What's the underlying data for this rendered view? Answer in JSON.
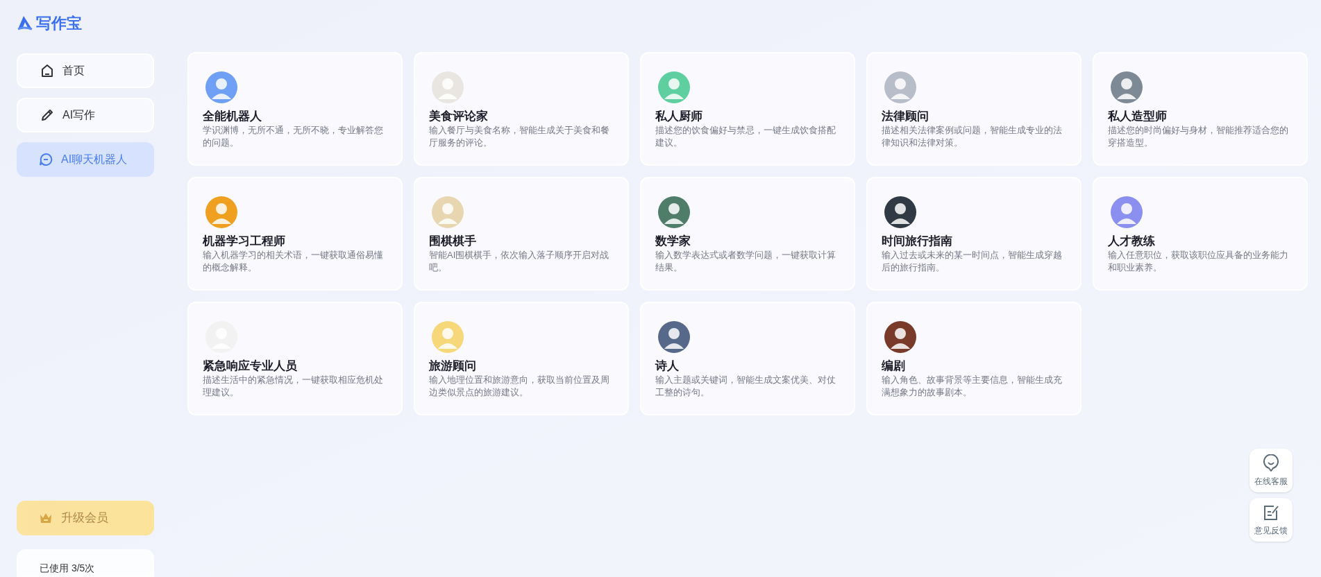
{
  "logo": {
    "text": "写作宝"
  },
  "sidebar": {
    "items": [
      {
        "label": "首页",
        "selected": false
      },
      {
        "label": "AI写作",
        "selected": false
      },
      {
        "label": "AI聊天机器人",
        "selected": true
      }
    ],
    "upgrade_button": "升级会员",
    "usage": "已使用 3/5次"
  },
  "cards": [
    {
      "title": "全能机器人",
      "description": "学识渊博，无所不通，无所不晓，专业解答您的问题。"
    },
    {
      "title": "美食评论家",
      "description": "输入餐厅与美食名称，智能生成关于美食和餐厅服务的评论。"
    },
    {
      "title": "私人厨师",
      "description": "描述您的饮食偏好与禁忌，一键生成饮食搭配建议。"
    },
    {
      "title": "法律顾问",
      "description": "描述相关法律案例或问题，智能生成专业的法律知识和法律对策。"
    },
    {
      "title": "私人造型师",
      "description": "描述您的时尚偏好与身材，智能推荐适合您的穿搭造型。"
    },
    {
      "title": "机器学习工程师",
      "description": "输入机器学习的相关术语，一键获取通俗易懂的概念解释。"
    },
    {
      "title": "围棋棋手",
      "description": "智能AI围棋棋手，依次输入落子顺序开启对战吧。"
    },
    {
      "title": "数学家",
      "description": "输入数学表达式或者数学问题，一键获取计算结果。"
    },
    {
      "title": "时间旅行指南",
      "description": "输入过去或未来的某一时间点，智能生成穿越后的旅行指南。"
    },
    {
      "title": "人才教练",
      "description": "输入任意职位，获取该职位应具备的业务能力和职业素养。"
    },
    {
      "title": "紧急响应专业人员",
      "description": "描述生活中的紧急情况，一键获取相应危机处理建议。"
    },
    {
      "title": "旅游顾问",
      "description": "输入地理位置和旅游意向，获取当前位置及周边类似景点的旅游建议。"
    },
    {
      "title": "诗人",
      "description": "输入主题或关键词，智能生成文案优美、对仗工整的诗句。"
    },
    {
      "title": "编剧",
      "description": "输入角色、故事背景等主要信息，智能生成充满想象力的故事剧本。"
    }
  ],
  "float_buttons": [
    {
      "label": "在线客服"
    },
    {
      "label": "意见反馈"
    }
  ]
}
